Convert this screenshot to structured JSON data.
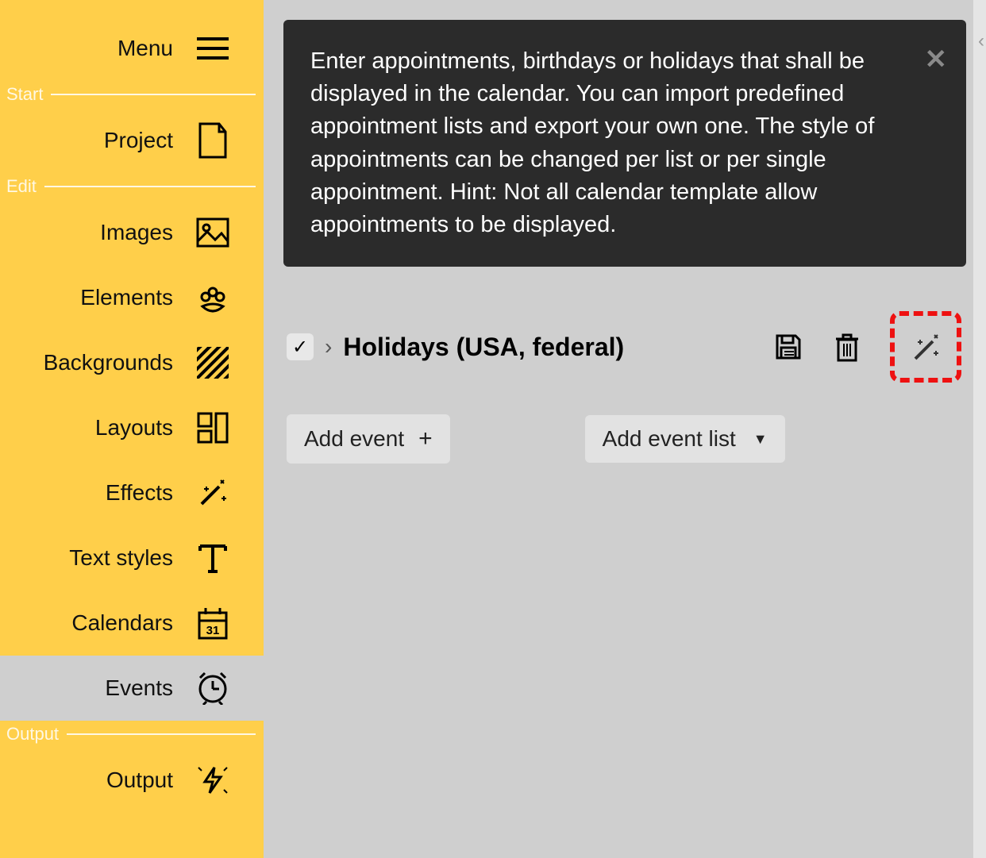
{
  "menu": {
    "label": "Menu"
  },
  "sections": {
    "start": "Start",
    "edit": "Edit",
    "output": "Output"
  },
  "sidebar": {
    "project": "Project",
    "images": "Images",
    "elements": "Elements",
    "backgrounds": "Backgrounds",
    "layouts": "Layouts",
    "effects": "Effects",
    "text_styles": "Text styles",
    "calendars": "Calendars",
    "events": "Events",
    "output": "Output"
  },
  "hint": {
    "text": "Enter appointments, birthdays or holidays that shall be displayed in the calendar. You can import predefined appointment lists and export your own one. The style of appointments can be changed per list or per single appointment. Hint: Not all calendar template allow appointments to be displayed."
  },
  "event_list": {
    "checked": true,
    "title": "Holidays (USA, federal)"
  },
  "buttons": {
    "add_event": "Add event",
    "add_event_list": "Add event list"
  }
}
